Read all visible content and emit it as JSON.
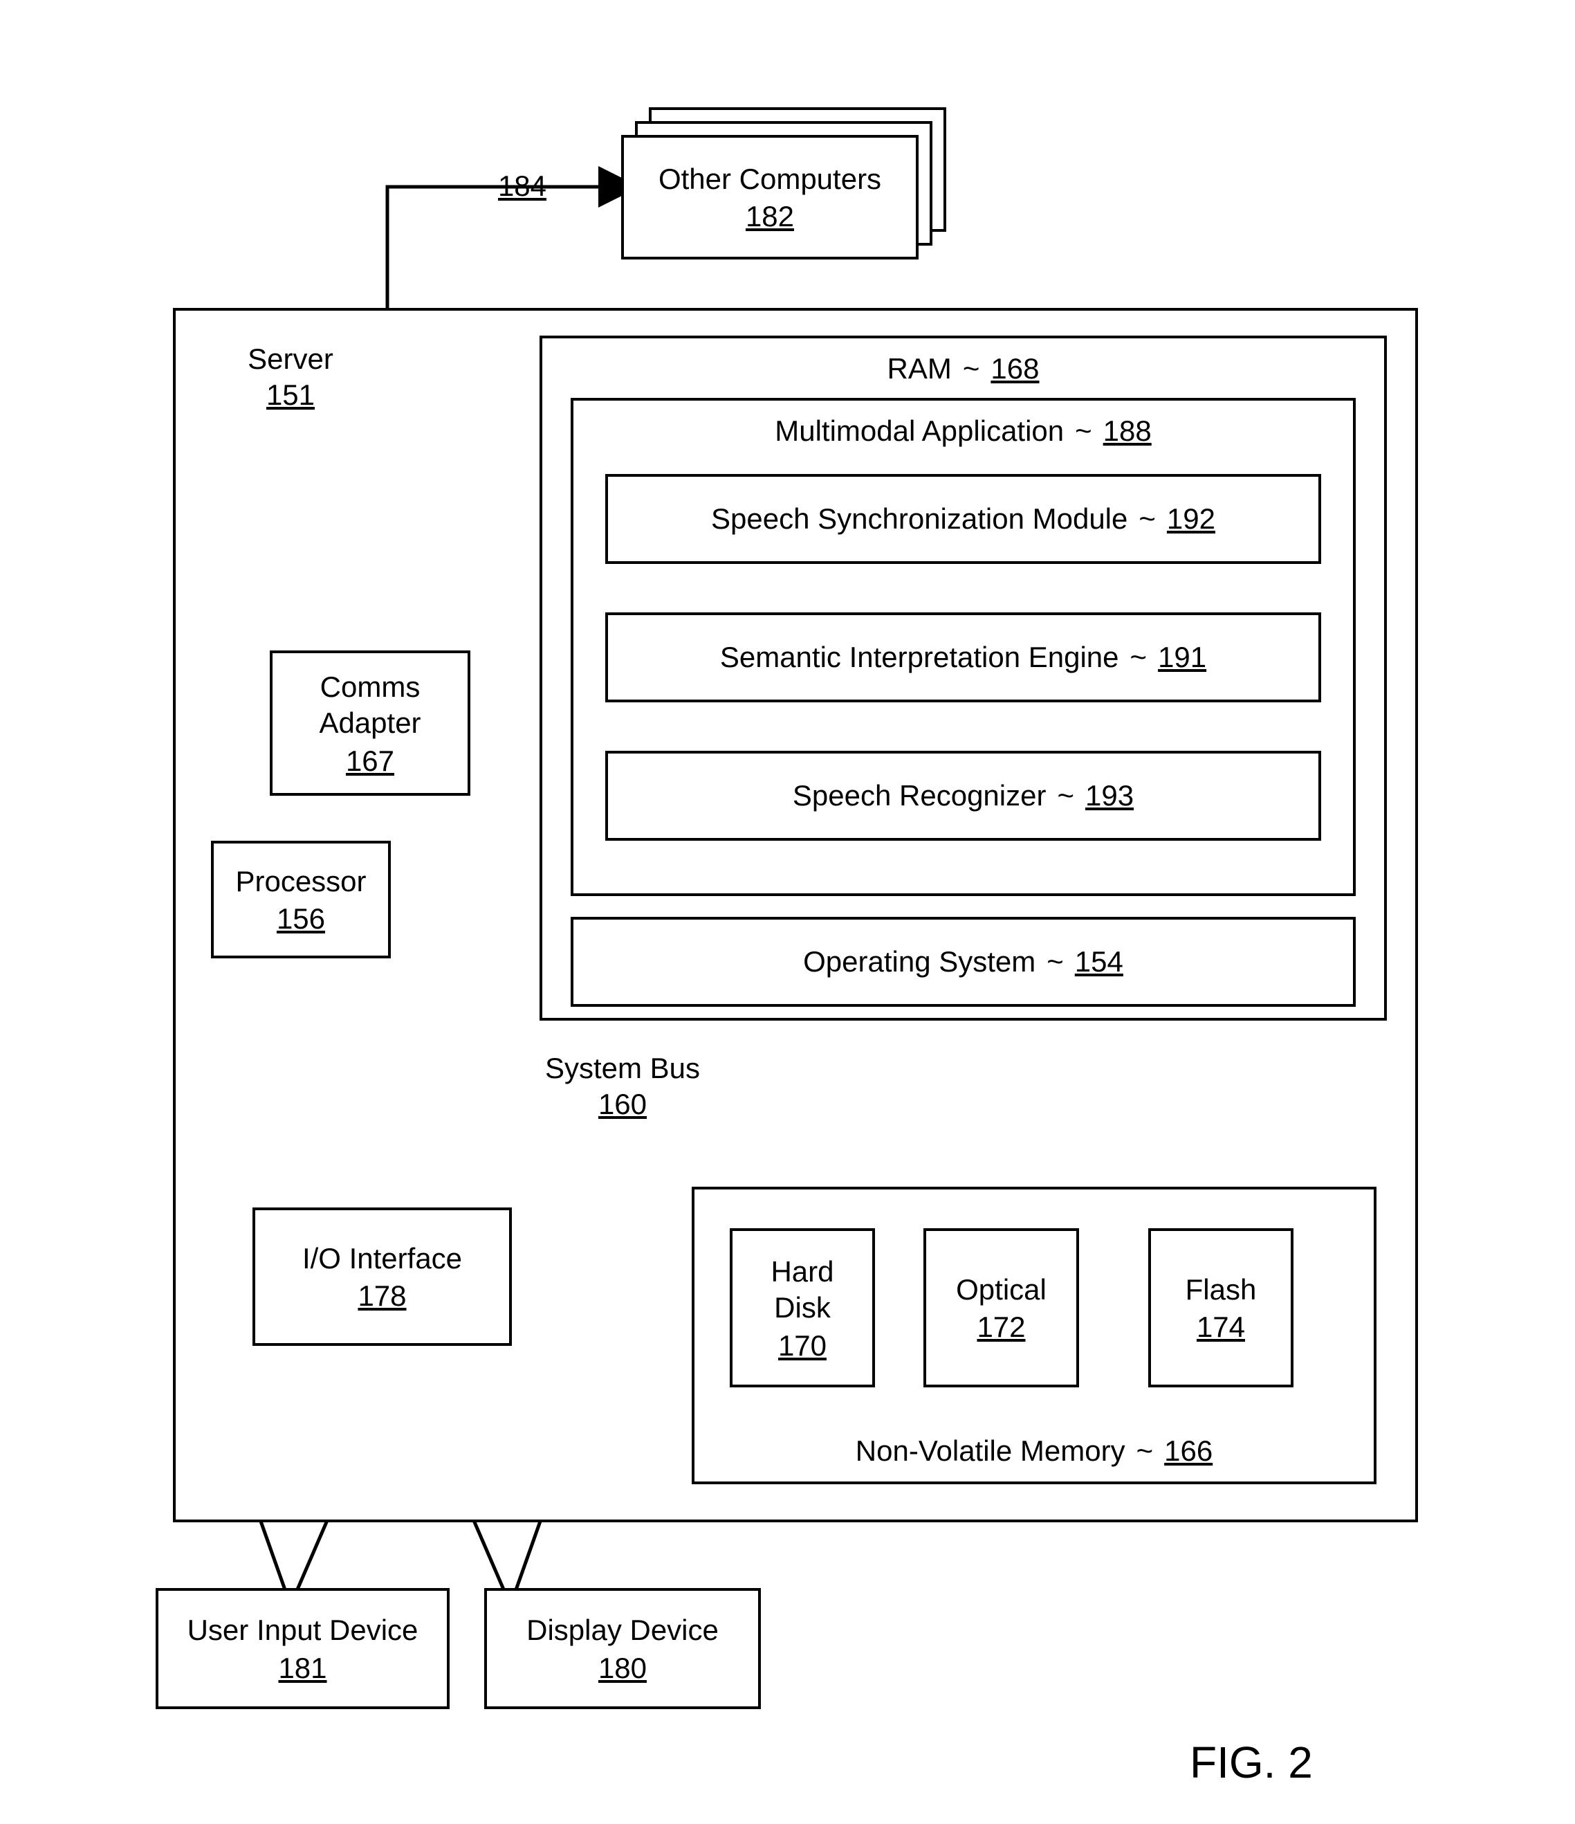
{
  "figure_label": "FIG. 2",
  "other_computers": {
    "label": "Other Computers",
    "num": "182"
  },
  "net_link": {
    "num": "184"
  },
  "server": {
    "label": "Server",
    "num": "151"
  },
  "ram": {
    "label": "RAM",
    "num": "168"
  },
  "multimodal": {
    "label": "Multimodal Application",
    "num": "188"
  },
  "sync": {
    "label": "Speech Synchronization Module",
    "num": "192"
  },
  "sem": {
    "label": "Semantic Interpretation Engine",
    "num": "191"
  },
  "rec": {
    "label": "Speech Recognizer",
    "num": "193"
  },
  "os": {
    "label": "Operating System",
    "num": "154"
  },
  "comms": {
    "label": "Comms Adapter",
    "num": "167"
  },
  "processor": {
    "label": "Processor",
    "num": "156"
  },
  "system_bus": {
    "label": "System Bus",
    "num": "160"
  },
  "io": {
    "label": "I/O Interface",
    "num": "178"
  },
  "nvmem": {
    "label": "Non-Volatile Memory",
    "num": "166"
  },
  "hdd": {
    "label": "Hard Disk",
    "num": "170"
  },
  "optical": {
    "label": "Optical",
    "num": "172"
  },
  "flash": {
    "label": "Flash",
    "num": "174"
  },
  "uid": {
    "label": "User Input Device",
    "num": "181"
  },
  "display": {
    "label": "Display Device",
    "num": "180"
  }
}
